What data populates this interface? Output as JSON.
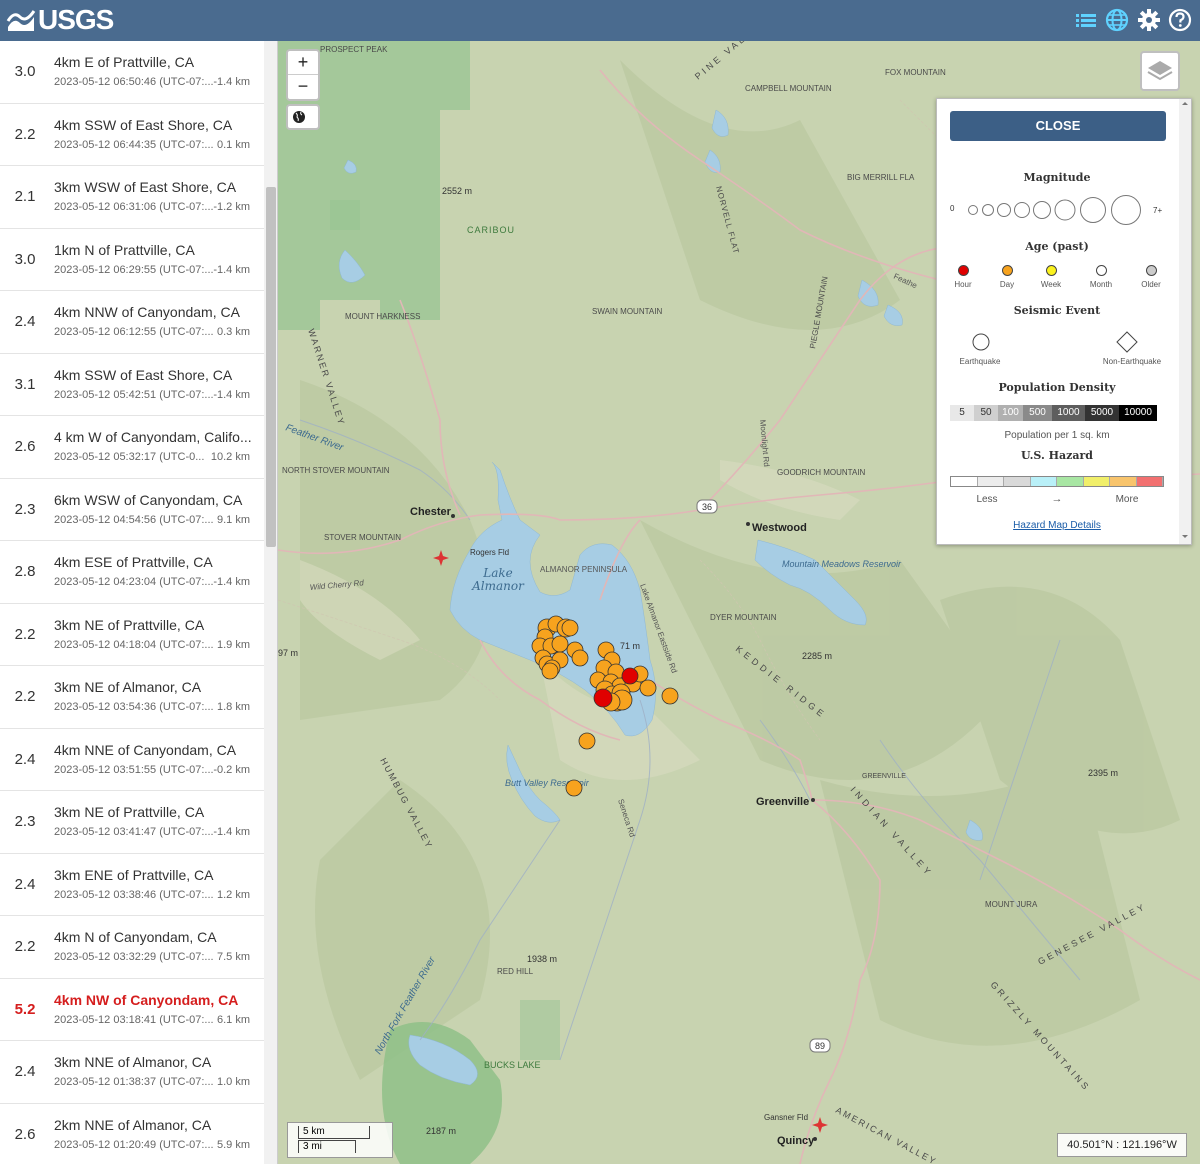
{
  "header": {
    "logo_text": "USGS",
    "bg_color": "#4a6b8f"
  },
  "earthquakes": [
    {
      "mag": "3.0",
      "place": "4km E of Prattville, CA",
      "time": "2023-05-12 06:50:46 (UTC-07:...",
      "depth": "-1.4 km"
    },
    {
      "mag": "2.2",
      "place": "4km SSW of East Shore, CA",
      "time": "2023-05-12 06:44:35 (UTC-07:...",
      "depth": "0.1 km"
    },
    {
      "mag": "2.1",
      "place": "3km WSW of East Shore, CA",
      "time": "2023-05-12 06:31:06 (UTC-07:...",
      "depth": "-1.2 km"
    },
    {
      "mag": "3.0",
      "place": "1km N of Prattville, CA",
      "time": "2023-05-12 06:29:55 (UTC-07:...",
      "depth": "-1.4 km"
    },
    {
      "mag": "2.4",
      "place": "4km NNW of Canyondam, CA",
      "time": "2023-05-12 06:12:55 (UTC-07:...",
      "depth": "0.3 km"
    },
    {
      "mag": "3.1",
      "place": "4km SSW of East Shore, CA",
      "time": "2023-05-12 05:42:51 (UTC-07:...",
      "depth": "-1.4 km"
    },
    {
      "mag": "2.6",
      "place": "4 km W of Canyondam, Califo...",
      "time": "2023-05-12 05:32:17 (UTC-0...",
      "depth": "10.2 km"
    },
    {
      "mag": "2.3",
      "place": "6km WSW of Canyondam, CA",
      "time": "2023-05-12 04:54:56 (UTC-07:...",
      "depth": "9.1 km"
    },
    {
      "mag": "2.8",
      "place": "4km ESE of Prattville, CA",
      "time": "2023-05-12 04:23:04 (UTC-07:...",
      "depth": "-1.4 km"
    },
    {
      "mag": "2.2",
      "place": "3km NE of Prattville, CA",
      "time": "2023-05-12 04:18:04 (UTC-07:...",
      "depth": "1.9 km"
    },
    {
      "mag": "2.2",
      "place": "3km NE of Almanor, CA",
      "time": "2023-05-12 03:54:36 (UTC-07:...",
      "depth": "1.8 km"
    },
    {
      "mag": "2.4",
      "place": "4km NNE of Canyondam, CA",
      "time": "2023-05-12 03:51:55 (UTC-07:...",
      "depth": "-0.2 km"
    },
    {
      "mag": "2.3",
      "place": "3km NE of Prattville, CA",
      "time": "2023-05-12 03:41:47 (UTC-07:...",
      "depth": "-1.4 km"
    },
    {
      "mag": "2.4",
      "place": "3km ENE of Prattville, CA",
      "time": "2023-05-12 03:38:46 (UTC-07:...",
      "depth": "1.2 km"
    },
    {
      "mag": "2.2",
      "place": "4km N of Canyondam, CA",
      "time": "2023-05-12 03:32:29 (UTC-07:...",
      "depth": "7.5 km"
    },
    {
      "mag": "5.2",
      "place": "4km NW of Canyondam, CA",
      "time": "2023-05-12 03:18:41 (UTC-07:...",
      "depth": "6.1 km",
      "big": true
    },
    {
      "mag": "2.4",
      "place": "3km NNE of Almanor, CA",
      "time": "2023-05-12 01:38:37 (UTC-07:...",
      "depth": "1.0 km"
    },
    {
      "mag": "2.6",
      "place": "2km NNE of Almanor, CA",
      "time": "2023-05-12 01:20:49 (UTC-07:...",
      "depth": "5.9 km"
    }
  ],
  "map": {
    "zoom_in": "+",
    "zoom_out": "−",
    "labels": {
      "lake_almanor": "Lake\nAlmanor",
      "chester": "Chester",
      "westwood": "Westwood",
      "greenville": "Greenville",
      "quincy": "Quincy",
      "caribou": "CARIBOU",
      "almanor_peninsula": "ALMANOR PENINSULA",
      "butt_valley": "Butt Valley Reservoir",
      "mountain_meadows": "Mountain Meadows Reservoir",
      "bucks_lake": "BUCKS LAKE",
      "dyer_mountain": "DYER MOUNTAIN",
      "red_hill": "RED HILL",
      "mount_harkness": "MOUNT HARKNESS",
      "stover_mountain": "STOVER MOUNTAIN",
      "north_stover": "NORTH STOVER MOUNTAIN",
      "swain_mountain": "SWAIN MOUNTAIN",
      "campbell_mountain": "CAMPBELL MOUNTAIN",
      "fox_mountain": "FOX MOUNTAIN",
      "goodrich_mountain": "GOODRICH MOUNTAIN",
      "big_merrill": "BIG MERRILL FLA",
      "mount_jura": "MOUNT JURA",
      "rogers_fld": "Rogers Fld",
      "gansner_fld": "Gansner Fld",
      "wild_cherry": "Wild Cherry Rd",
      "feather_river": "Feather River",
      "north_fork": "North Fork Feather River",
      "keddie_ridge": "KEDDIE RIDGE",
      "indian_valley": "INDIAN VALLEY",
      "humbug_valley": "HUMBUG VALLEY",
      "warner_valley": "WARNER VALLEY",
      "grizzly_mountains": "GRIZZLY MOUNTAINS",
      "genesee_valley": "GENESEE VALLEY",
      "american_valley": "AMERICAN VALLEY",
      "greenville_small": "GREENVILLE",
      "pine_valley": "PINE VALLEY",
      "norvell_flat": "NORVELL FLAT",
      "piegle_mountain": "PIEGLE MOUNTAIN",
      "elev_2552": "2552 m",
      "elev_2285": "2285 m",
      "elev_2395": "2395 m",
      "elev_1938": "1938 m",
      "elev_2187": "2187 m",
      "elev_97": "97 m",
      "elev_71": "71 m",
      "route_36": "36",
      "route_89": "89",
      "prospect_peak": "PROSPECT PEAK",
      "lake_almanor_east": "Lake Almanor Eastside Rd",
      "seneca_rd": "Seneca Rd",
      "moonlight_rd": "Moonlight Rd",
      "feather_rd": "Feathe"
    },
    "scale": {
      "km": "5 km",
      "mi": "3 mi"
    },
    "coords": "40.501°N : 121.196°W"
  },
  "legend": {
    "close": "CLOSE",
    "magnitude_title": "Magnitude",
    "mag_min": "0",
    "mag_max": "7+",
    "age_title": "Age (past)",
    "ages": [
      {
        "label": "Hour",
        "color": "#e00000"
      },
      {
        "label": "Day",
        "color": "#f7a31e"
      },
      {
        "label": "Week",
        "color": "#fbf21d"
      },
      {
        "label": "Month",
        "color": "#ffffff"
      },
      {
        "label": "Older",
        "color": "#cccccc"
      }
    ],
    "seismic_title": "Seismic Event",
    "earthquake": "Earthquake",
    "non_earthquake": "Non-Earthquake",
    "pop_title": "Population Density",
    "pop_values": [
      "5",
      "50",
      "100",
      "500",
      "1000",
      "5000",
      "10000"
    ],
    "pop_sub": "Population per 1 sq. km",
    "hazard_title": "U.S. Hazard",
    "hazard_less": "Less",
    "hazard_arrow": "→",
    "hazard_more": "More",
    "hazard_link": "Hazard Map Details"
  }
}
